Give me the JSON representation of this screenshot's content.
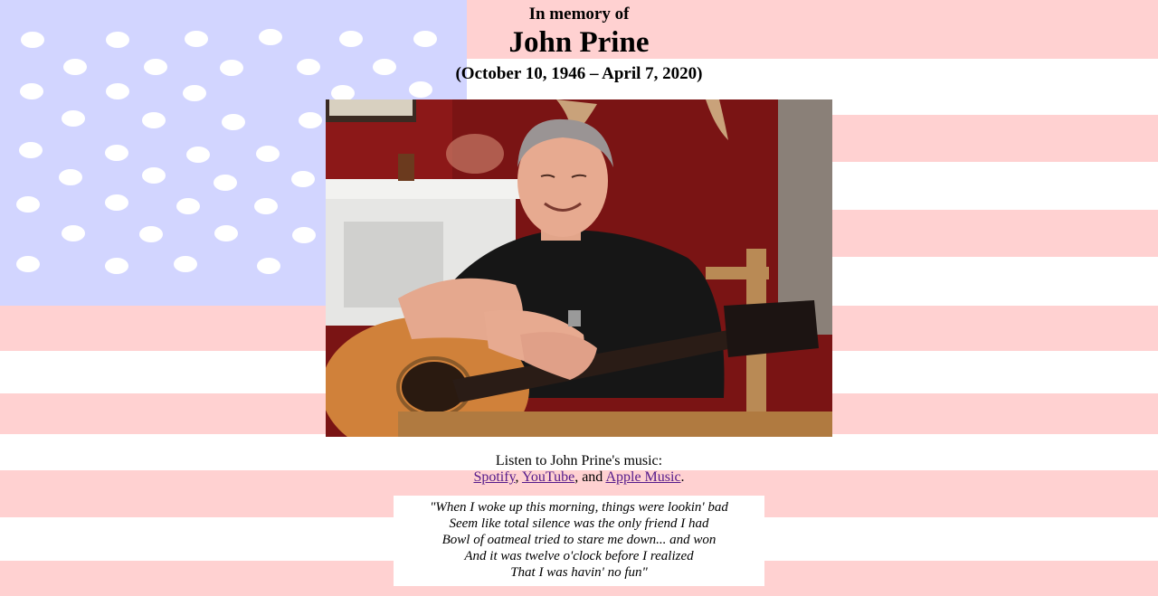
{
  "header": {
    "in_memory": "In memory of",
    "name": "John Prine",
    "dates": "(October 10, 1946 – April 7, 2020)"
  },
  "photo": {
    "subject": "photo-of-john-prine-with-guitar"
  },
  "listen": {
    "intro": "Listen to John Prine's music:",
    "links": [
      {
        "label": "Spotify"
      },
      {
        "label": "YouTube"
      },
      {
        "label": "Apple Music"
      }
    ],
    "sep1": ",",
    "sep2": ", and",
    "end": "."
  },
  "quote": {
    "lines": [
      "\"When I woke up this morning, things were lookin' bad",
      "Seem like total silence was the only friend I had",
      "Bowl of oatmeal tried to stare me down... and won",
      "And it was twelve o'clock before I realized",
      "That I was havin' no fun\""
    ]
  },
  "colors": {
    "stripe": "#ffd1d1",
    "canton": "#d2d5ff",
    "link": "#551a8b"
  }
}
